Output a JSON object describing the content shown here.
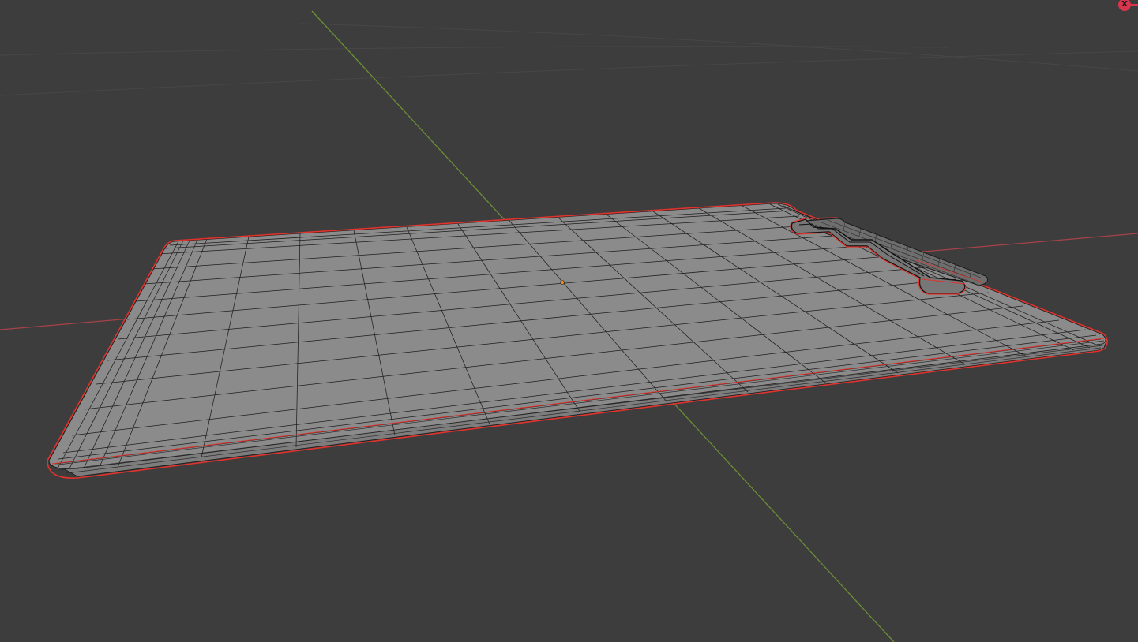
{
  "viewport": {
    "background": "#3d3d3d",
    "shading": "wireframe",
    "axes": {
      "x_color": "#c8454e",
      "y_color": "#6a8f35"
    },
    "selection_outline": "#e0332d",
    "object_origin_color": "#f08a1a"
  },
  "gizmo": {
    "x_label": "X",
    "x_color": "#d9364e"
  }
}
